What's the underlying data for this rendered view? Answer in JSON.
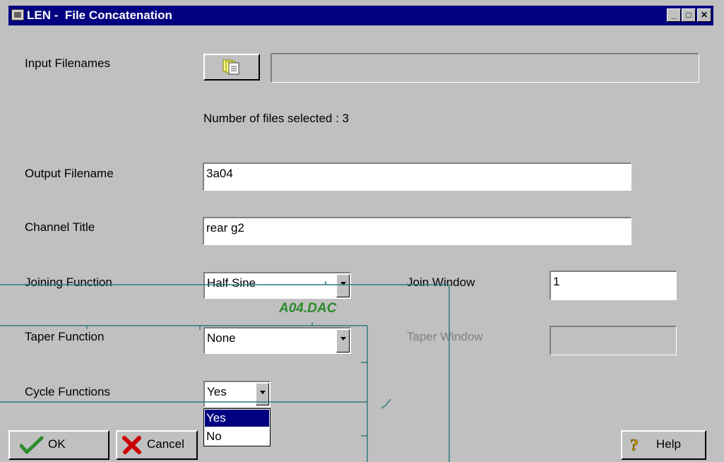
{
  "window": {
    "title": "LEN -  File Concatenation",
    "controls": {
      "minimize": "_",
      "maximize": "□",
      "close": "✕"
    }
  },
  "form": {
    "input_filenames_label": "Input Filenames",
    "input_filenames_value": "",
    "files_selected_text": "Number of files selected : 3",
    "output_filename_label": "Output Filename",
    "output_filename_value": "3a04",
    "channel_title_label": "Channel Title",
    "channel_title_value": "rear g2",
    "joining_function_label": "Joining Function",
    "joining_function_value": "Half Sine",
    "join_window_label": "Join Window",
    "join_window_value": "1",
    "taper_function_label": "Taper Function",
    "taper_function_value": "None",
    "taper_window_label": "Taper Window",
    "taper_window_value": "",
    "cycle_functions_label": "Cycle Functions",
    "cycle_functions_value": "Yes",
    "cycle_options": [
      "Yes",
      "No"
    ],
    "cycle_selected_index": 0
  },
  "buttons": {
    "ok": "OK",
    "cancel": "Cancel",
    "help": "Help"
  },
  "overlay": {
    "annotation_text": "A04.DAC",
    "line_color": "#2f7a78",
    "annotation_color": "#2e8b2e"
  },
  "colors": {
    "titlebar": "#000080",
    "window_bg": "#c0c0c0",
    "selection": "#000080"
  }
}
